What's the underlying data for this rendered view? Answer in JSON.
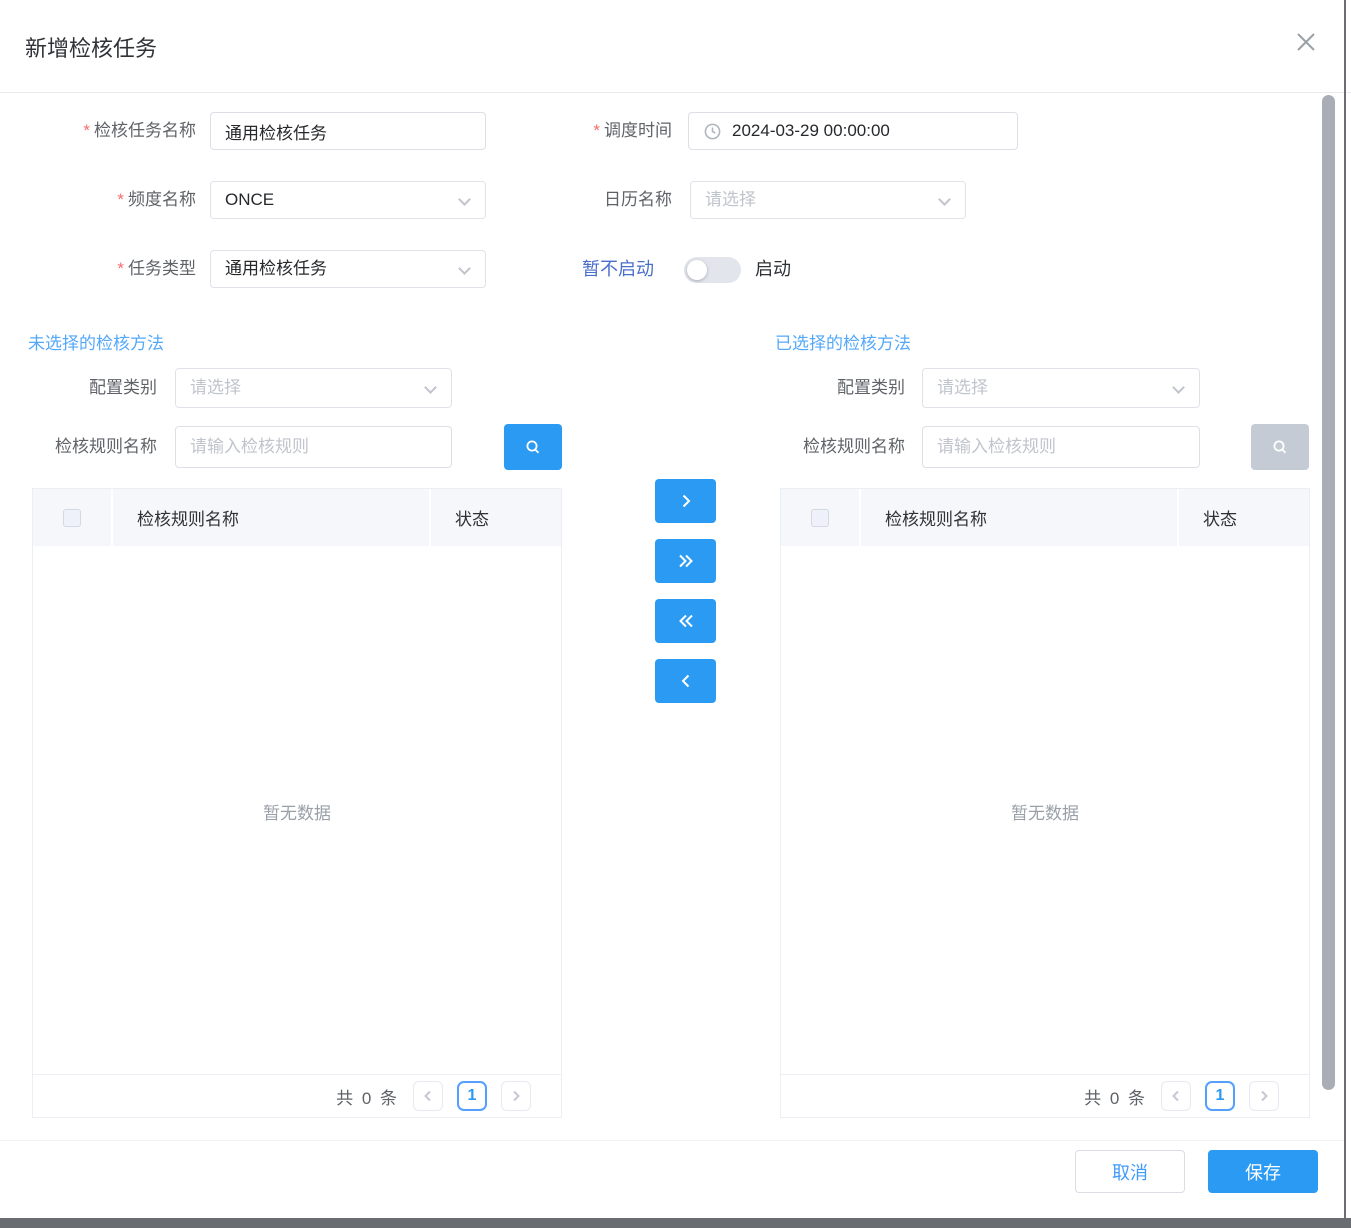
{
  "colors": {
    "primary_blue": "#2b9af3",
    "section_link_blue": "#54a8f8",
    "toggle_label_blue": "#4a6fca",
    "required_red": "#f56c6c",
    "disabled_gray": "#c5cbd5"
  },
  "dialog": {
    "title": "新增检核任务",
    "required_mark": "*",
    "close_icon": "close-icon"
  },
  "form": {
    "task_name_label": "检核任务名称",
    "task_name_value": "通用检核任务",
    "schedule_time_label": "调度时间",
    "schedule_time_value": "2024-03-29 00:00:00",
    "schedule_time_icon": "clock-icon",
    "frequency_label": "频度名称",
    "frequency_value": "ONCE",
    "calendar_label": "日历名称",
    "calendar_placeholder": "请选择",
    "task_type_label": "任务类型",
    "task_type_value": "通用检核任务",
    "launch_off_label": "暂不启动",
    "launch_on_label": "启动",
    "launch_state": "off"
  },
  "unselected": {
    "title": "未选择的检核方法",
    "category_label": "配置类别",
    "category_placeholder": "请选择",
    "rule_label": "检核规则名称",
    "rule_placeholder": "请输入检核规则",
    "search_icon": "search-icon",
    "columns": [
      "检核规则名称",
      "状态"
    ],
    "rows": [],
    "empty_text": "暂无数据",
    "total_text": "共 0 条",
    "current_page": "1"
  },
  "selected": {
    "title": "已选择的检核方法",
    "category_label": "配置类别",
    "category_placeholder": "请选择",
    "rule_label": "检核规则名称",
    "rule_placeholder": "请输入检核规则",
    "search_icon": "search-icon",
    "search_disabled": true,
    "columns": [
      "检核规则名称",
      "状态"
    ],
    "rows": [],
    "empty_text": "暂无数据",
    "total_text": "共 0 条",
    "current_page": "1"
  },
  "transfer": {
    "buttons": [
      {
        "name": "move-right-button",
        "icon": "chevron-right-icon"
      },
      {
        "name": "move-all-right-button",
        "icon": "double-chevron-right-icon"
      },
      {
        "name": "move-all-left-button",
        "icon": "double-chevron-left-icon"
      },
      {
        "name": "move-left-button",
        "icon": "chevron-left-icon"
      }
    ]
  },
  "footer": {
    "cancel_label": "取消",
    "save_label": "保存"
  }
}
